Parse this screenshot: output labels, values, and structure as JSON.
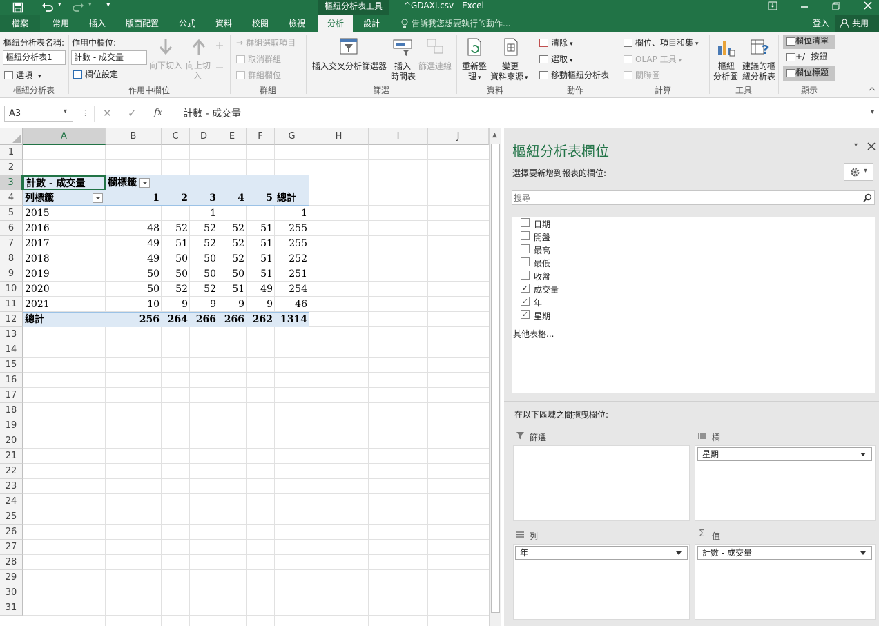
{
  "titlebar": {
    "context_tab": "樞紐分析表工具",
    "doc_title": "^GDAXI.csv - Excel",
    "undo_icon": "undo-icon",
    "redo_icon": "redo-icon",
    "save_icon": "save-icon"
  },
  "tabs": [
    {
      "label": "檔案"
    },
    {
      "label": "常用"
    },
    {
      "label": "插入"
    },
    {
      "label": "版面配置"
    },
    {
      "label": "公式"
    },
    {
      "label": "資料"
    },
    {
      "label": "校閱"
    },
    {
      "label": "檢視"
    },
    {
      "label": "分析",
      "active": true
    },
    {
      "label": "設計"
    }
  ],
  "tell_me": "告訴我您想要執行的動作...",
  "signin": "登入",
  "share": "共用",
  "ribbon": {
    "pivot_name_label": "樞紐分析表名稱:",
    "pivot_name_value": "樞紐分析表1",
    "options_label": "選項",
    "group_pivottable": "樞紐分析表",
    "active_field_label": "作用中欄位:",
    "active_field_value": "計數 - 成交量",
    "field_settings": "欄位設定",
    "drill_down": "向下切入",
    "drill_up": "向上切",
    "drill_up2": "入",
    "group_active_field": "作用中欄位",
    "group_selection": "群組選取項目",
    "ungroup": "取消群組",
    "group_field": "群組欄位",
    "group_group": "群組",
    "insert_slicer": "插入交叉分析篩選器",
    "insert_timeline": "插入",
    "insert_timeline2": "時間表",
    "filter_connections": "篩選連線",
    "group_filter": "篩選",
    "refresh": "重新整",
    "refresh2": "理",
    "change_source": "變更",
    "change_source2": "資料來源",
    "group_data": "資料",
    "clear": "清除",
    "select": "選取",
    "move_pivot": "移動樞紐分析表",
    "group_actions": "動作",
    "fields_items_sets": "欄位、項目和集",
    "olap_tools": "OLAP 工具",
    "relationships": "關聯圖",
    "group_calculations": "計算",
    "pivot_chart": "樞紐",
    "pivot_chart2": "分析圖",
    "recommended": "建議的樞",
    "recommended2": "紐分析表",
    "group_tools": "工具",
    "field_list": "欄位清單",
    "buttons": "+/- 按鈕",
    "field_headers": "欄位標題",
    "group_show": "顯示"
  },
  "formula_bar": {
    "name_box": "A3",
    "fx": "fx",
    "formula": "計數 - 成交量"
  },
  "sheet": {
    "columns": [
      "A",
      "B",
      "C",
      "D",
      "E",
      "F",
      "G",
      "H",
      "I",
      "J"
    ],
    "rows": [
      "1",
      "2",
      "3",
      "4",
      "5",
      "6",
      "7",
      "8",
      "9",
      "10",
      "11",
      "12",
      "13",
      "14",
      "15",
      "16",
      "17",
      "18",
      "19",
      "20",
      "21",
      "22",
      "23",
      "24",
      "25",
      "26",
      "27",
      "28",
      "29",
      "30",
      "31"
    ],
    "pivot": {
      "value_caption": "計數 - 成交量",
      "col_caption": "欄標籤",
      "row_caption": "列標籤",
      "col_headers": [
        "1",
        "2",
        "3",
        "4",
        "5",
        "總計"
      ],
      "data": [
        {
          "label": "2015",
          "values": [
            "",
            "",
            "1",
            "",
            "",
            "1"
          ]
        },
        {
          "label": "2016",
          "values": [
            "48",
            "52",
            "52",
            "52",
            "51",
            "255"
          ]
        },
        {
          "label": "2017",
          "values": [
            "49",
            "51",
            "52",
            "52",
            "51",
            "255"
          ]
        },
        {
          "label": "2018",
          "values": [
            "49",
            "50",
            "50",
            "52",
            "51",
            "252"
          ]
        },
        {
          "label": "2019",
          "values": [
            "50",
            "50",
            "50",
            "50",
            "51",
            "251"
          ]
        },
        {
          "label": "2020",
          "values": [
            "50",
            "52",
            "52",
            "51",
            "49",
            "254"
          ]
        },
        {
          "label": "2021",
          "values": [
            "10",
            "9",
            "9",
            "9",
            "9",
            "46"
          ]
        }
      ],
      "total_label": "總計",
      "totals": [
        "256",
        "264",
        "266",
        "266",
        "262",
        "1314"
      ]
    }
  },
  "panel": {
    "title": "樞紐分析表欄位",
    "choose_label": "選擇要新增到報表的欄位:",
    "search_placeholder": "搜尋",
    "fields": [
      {
        "label": "日期",
        "checked": false
      },
      {
        "label": "開盤",
        "checked": false
      },
      {
        "label": "最高",
        "checked": false
      },
      {
        "label": "最低",
        "checked": false
      },
      {
        "label": "收盤",
        "checked": false
      },
      {
        "label": "成交量",
        "checked": true
      },
      {
        "label": "年",
        "checked": true
      },
      {
        "label": "星期",
        "checked": true
      }
    ],
    "more_tables": "其他表格...",
    "drag_label": "在以下區域之間拖曳欄位:",
    "filters_label": "篩選",
    "columns_label": "欄",
    "rows_label": "列",
    "values_label": "值",
    "columns_item": "星期",
    "rows_item": "年",
    "values_item": "計數 - 成交量"
  }
}
